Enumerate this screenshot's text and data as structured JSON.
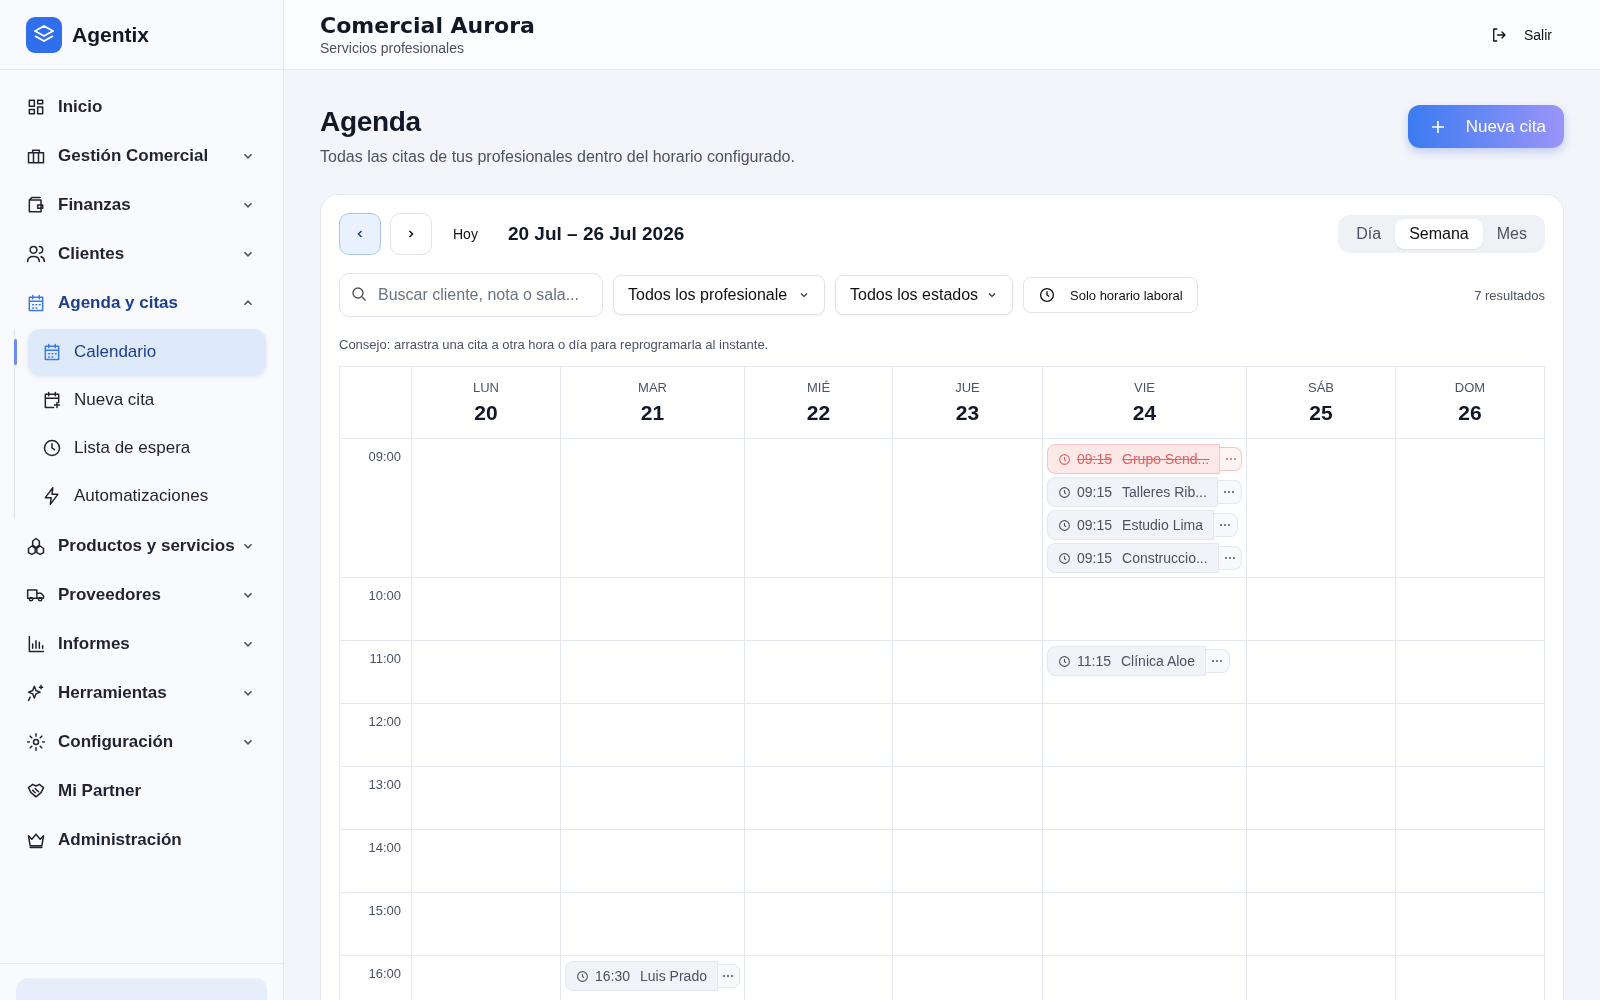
{
  "brand": {
    "name": "Agentix"
  },
  "sidebar": {
    "items": [
      {
        "label": "Inicio",
        "selected": false
      },
      {
        "label": "Gestión Comercial",
        "selected": false,
        "expanded": false
      },
      {
        "label": "Finanzas",
        "selected": false,
        "expanded": false
      },
      {
        "label": "Clientes",
        "selected": false,
        "expanded": false
      },
      {
        "label": "Agenda y citas",
        "selected": true,
        "expanded": true,
        "children": [
          {
            "label": "Calendario",
            "selected": true
          },
          {
            "label": "Nueva cita",
            "selected": false
          },
          {
            "label": "Lista de espera",
            "selected": false
          },
          {
            "label": "Automatizaciones",
            "selected": false
          }
        ]
      },
      {
        "label": "Productos y servicios",
        "selected": false,
        "expanded": false
      },
      {
        "label": "Proveedores",
        "selected": false,
        "expanded": false
      },
      {
        "label": "Informes",
        "selected": false,
        "expanded": false
      },
      {
        "label": "Herramientas",
        "selected": false,
        "expanded": false
      },
      {
        "label": "Configuración",
        "selected": false,
        "expanded": false
      },
      {
        "label": "Mi Partner",
        "selected": false
      },
      {
        "label": "Administración",
        "selected": false
      }
    ]
  },
  "header": {
    "title": "Comercial Aurora",
    "subtitle": "Servicios profesionales",
    "logout": "Salir"
  },
  "page": {
    "title": "Agenda",
    "description": "Todas las citas de tus profesionales dentro del horario configurado.",
    "new_button": "Nueva cita"
  },
  "toolbar": {
    "prev_highlighted": true,
    "next_highlighted": false,
    "today": "Hoy",
    "range": "20 Jul – 26 Jul 2026",
    "views": [
      {
        "label": "Día",
        "selected": false
      },
      {
        "label": "Semana",
        "selected": true
      },
      {
        "label": "Mes",
        "selected": false
      }
    ]
  },
  "filters": {
    "search_placeholder": "Buscar cliente, nota o sala...",
    "professionals": "Todos los profesionale",
    "states": "Todos los estados",
    "work_hours": "Solo horario laboral",
    "results": "7 resultados"
  },
  "tip": "Consejo: arrastra una cita a otra hora o día para reprogramarla al instante.",
  "calendar": {
    "days": [
      {
        "name": "LUN",
        "date": "20"
      },
      {
        "name": "MAR",
        "date": "21"
      },
      {
        "name": "MIÉ",
        "date": "22"
      },
      {
        "name": "JUE",
        "date": "23"
      },
      {
        "name": "VIE",
        "date": "24"
      },
      {
        "name": "SÁB",
        "date": "25"
      },
      {
        "name": "DOM",
        "date": "26"
      }
    ],
    "rows": [
      {
        "time": "09:00",
        "cells": [
          {},
          {},
          {},
          {},
          {
            "events": [
              {
                "time": "09:15",
                "name": "Grupo Send...",
                "cancelled": true
              },
              {
                "time": "09:15",
                "name": "Talleres Rib...",
                "cancelled": false
              },
              {
                "time": "09:15",
                "name": "Estudio Lima",
                "cancelled": false
              },
              {
                "time": "09:15",
                "name": "Construccio...",
                "cancelled": false
              }
            ]
          },
          {},
          {}
        ]
      },
      {
        "time": "10:00",
        "cells": [
          {},
          {},
          {},
          {},
          {},
          {},
          {}
        ]
      },
      {
        "time": "11:00",
        "cells": [
          {},
          {},
          {},
          {},
          {
            "events": [
              {
                "time": "11:15",
                "name": "Clínica Aloe",
                "cancelled": false
              }
            ]
          },
          {},
          {}
        ]
      },
      {
        "time": "12:00",
        "cells": [
          {},
          {},
          {},
          {},
          {},
          {},
          {}
        ]
      },
      {
        "time": "13:00",
        "cells": [
          {},
          {},
          {},
          {},
          {},
          {},
          {}
        ]
      },
      {
        "time": "14:00",
        "cells": [
          {},
          {},
          {},
          {},
          {},
          {},
          {}
        ]
      },
      {
        "time": "15:00",
        "cells": [
          {},
          {},
          {},
          {},
          {},
          {},
          {}
        ]
      },
      {
        "time": "16:00",
        "cells": [
          {},
          {
            "events": [
              {
                "time": "16:30",
                "name": "Luis Prado",
                "cancelled": false
              }
            ]
          },
          {},
          {},
          {},
          {},
          {}
        ]
      }
    ]
  }
}
